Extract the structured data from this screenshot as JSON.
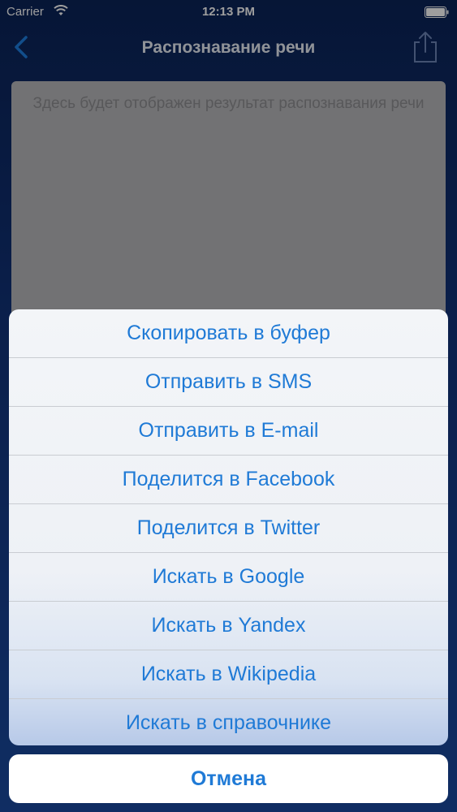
{
  "status_bar": {
    "carrier": "Carrier",
    "time": "12:13 PM"
  },
  "nav": {
    "title": "Распознавание речи",
    "back_icon": "chevron-left-icon",
    "share_icon": "share-icon"
  },
  "result": {
    "placeholder": "Здесь будет отображен результат распознавания речи"
  },
  "action_sheet": {
    "items": [
      "Скопировать в буфер",
      "Отправить в SMS",
      "Отправить в E-mail",
      "Поделится в Facebook",
      "Поделится в Twitter",
      "Искать в Google",
      "Искать в Yandex",
      "Искать в Wikipedia",
      "Искать в справочнике"
    ],
    "cancel_label": "Отмена"
  },
  "colors": {
    "accent": "#1f7ad6",
    "nav_background": "#0b2458"
  }
}
